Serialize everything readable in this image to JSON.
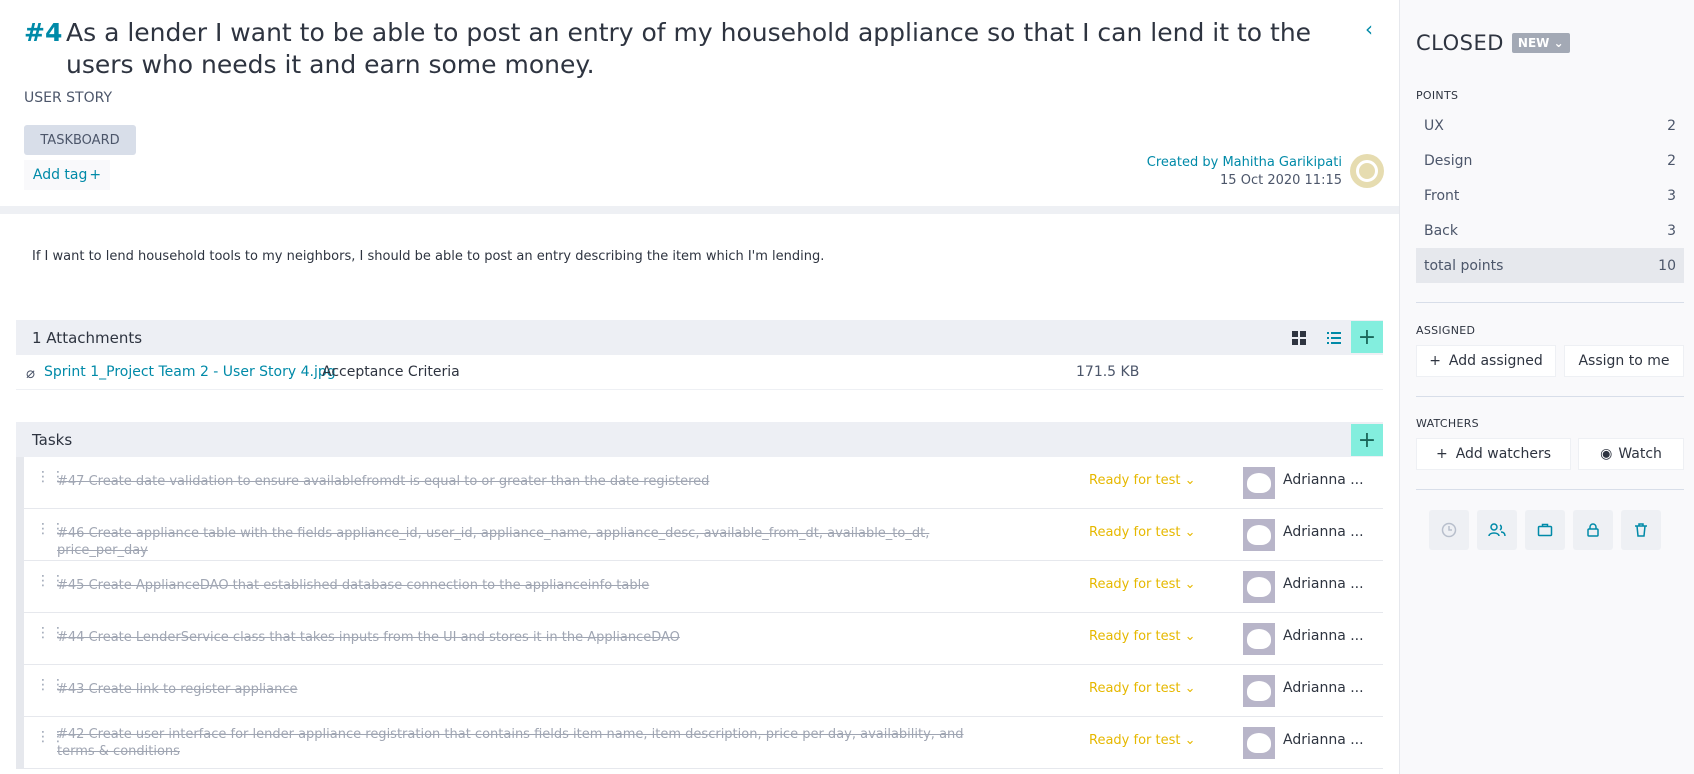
{
  "header": {
    "ref": "#4",
    "subject": "As a lender I want to be able to post an entry of my household appliance so that I can lend it to the users who needs it and earn some money.",
    "type": "USER STORY",
    "taskboard_label": "TASKBOARD",
    "add_tag_label": "Add tag",
    "created_by": "Created by Mahitha Garikipati",
    "created_date": "15 Oct 2020 11:15"
  },
  "description": "If I want to lend household tools to my neighbors, I should be able to post an entry describing the item which I'm lending.",
  "attachments": {
    "title": "1 Attachments",
    "items": [
      {
        "name": "Sprint 1_Project Team 2 - User Story 4.jpg",
        "description": "Acceptance Criteria",
        "size": "171.5 KB"
      }
    ]
  },
  "tasks": {
    "title": "Tasks",
    "items": [
      {
        "text": "#47 Create date validation to ensure availablefromdt is equal to or greater than the date registered",
        "status": "Ready for test",
        "assignee": "Adrianna ..."
      },
      {
        "text": "#46 Create appliance table with the fields appliance_id, user_id, appliance_name, appliance_desc, available_from_dt, available_to_dt, price_per_day",
        "status": "Ready for test",
        "assignee": "Adrianna ..."
      },
      {
        "text": "#45 Create ApplianceDAO that established database connection to the applianceinfo table",
        "status": "Ready for test",
        "assignee": "Adrianna ..."
      },
      {
        "text": "#44 Create LenderService class that takes inputs from the UI and stores it in the ApplianceDAO",
        "status": "Ready for test",
        "assignee": "Adrianna ..."
      },
      {
        "text": "#43 Create link to register appliance",
        "status": "Ready for test",
        "assignee": "Adrianna ..."
      },
      {
        "text": "#42 Create user interface for lender appliance registration that contains fields item name, item description, price per day, availability, and terms & conditions",
        "status": "Ready for test",
        "assignee": "Adrianna ..."
      }
    ]
  },
  "sidebar": {
    "status": "CLOSED",
    "status_badge": "NEW",
    "points_label": "POINTS",
    "points": [
      {
        "name": "UX",
        "value": "2"
      },
      {
        "name": "Design",
        "value": "2"
      },
      {
        "name": "Front",
        "value": "3"
      },
      {
        "name": "Back",
        "value": "3"
      }
    ],
    "total": {
      "name": "total points",
      "value": "10"
    },
    "assigned_label": "ASSIGNED",
    "add_assigned": "Add assigned",
    "assign_to_me": "Assign to me",
    "watchers_label": "WATCHERS",
    "add_watchers": "Add watchers",
    "watch": "Watch"
  },
  "colors": {
    "accent": "#008aa8",
    "add_button": "#83eede",
    "status_ready": "#e6b800"
  }
}
